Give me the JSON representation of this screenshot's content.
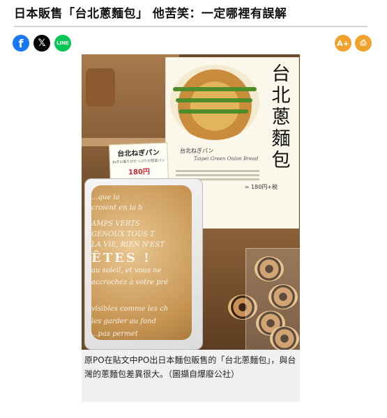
{
  "article": {
    "headline": "日本販售「台北蔥麵包」 他苦笑：一定哪裡有誤解",
    "caption": "原PO在貼文中PO出日本麵包販售的「台北蔥麵包」，與台灣的蔥麵包差異很大。（圖擷自爆廢公社）"
  },
  "share": {
    "facebook": "f",
    "x": "𝕏",
    "line": "LINE"
  },
  "tools": {
    "font_size": "A+",
    "print": "⎙"
  },
  "photo": {
    "poster_title": "台北蔥麵包",
    "poster_subtitle": "台北ねぎパン",
    "poster_english": "Taipei Green Onion Bread",
    "poster_price": "= 180円+税",
    "price_card_title": "台北ねぎパン",
    "price_card_note": "ねぎの香りがたっぷりの惣菜パン",
    "price_card_price": "180円",
    "bag_lines": [
      "...que la",
      "croient en la b",
      "AMPS VERTS",
      "GENOUX TOUS T",
      "LA VIE, RIEN N'EST",
      "ÊTES !",
      "au soleil, et vous ne",
      "accrochez à votre pré",
      "visibles comme les ch",
      "les garder au fond",
      "...pas permet"
    ]
  },
  "colors": {
    "facebook": "#1877f2",
    "x": "#000000",
    "line": "#06c755",
    "tool": "#f0a32c"
  }
}
